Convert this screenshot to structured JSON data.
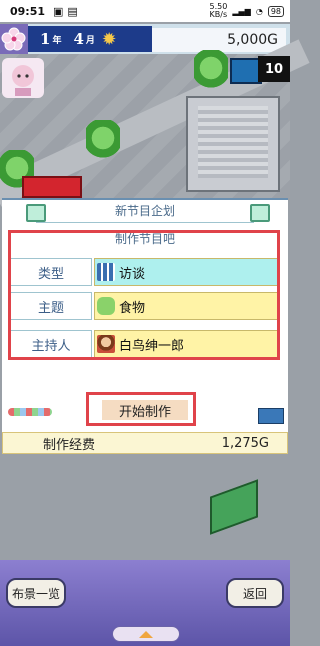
{
  "status_bar": {
    "time": "09:51",
    "net_speed": "5.50\nKB/s",
    "battery": "98"
  },
  "hud": {
    "year": "1",
    "year_unit": "年",
    "month": "4",
    "month_unit": "月",
    "money": "5,000G",
    "tv_count": "10"
  },
  "dialog": {
    "title": "新节目企划",
    "subtitle": "制作节目吧",
    "rows": [
      {
        "label": "类型",
        "value": "访谈",
        "icon": "grid-icon",
        "bg": "#aef0ee"
      },
      {
        "label": "主题",
        "value": "食物",
        "icon": "speech-bubble-icon",
        "bg": "#fff3a6"
      },
      {
        "label": "主持人",
        "value": "白鸟绅一郎",
        "icon": "host-portrait-icon",
        "bg": "#fff3a6"
      }
    ],
    "start_button": "开始制作"
  },
  "cost": {
    "label": "制作经费",
    "value": "1,275G"
  },
  "bottom": {
    "left_button": "布景一览",
    "right_button": "返回"
  },
  "colors": {
    "highlight_red": "#e0434a",
    "hud_navy": "#1d3b8a",
    "panel_purple": "#6f66b8"
  }
}
